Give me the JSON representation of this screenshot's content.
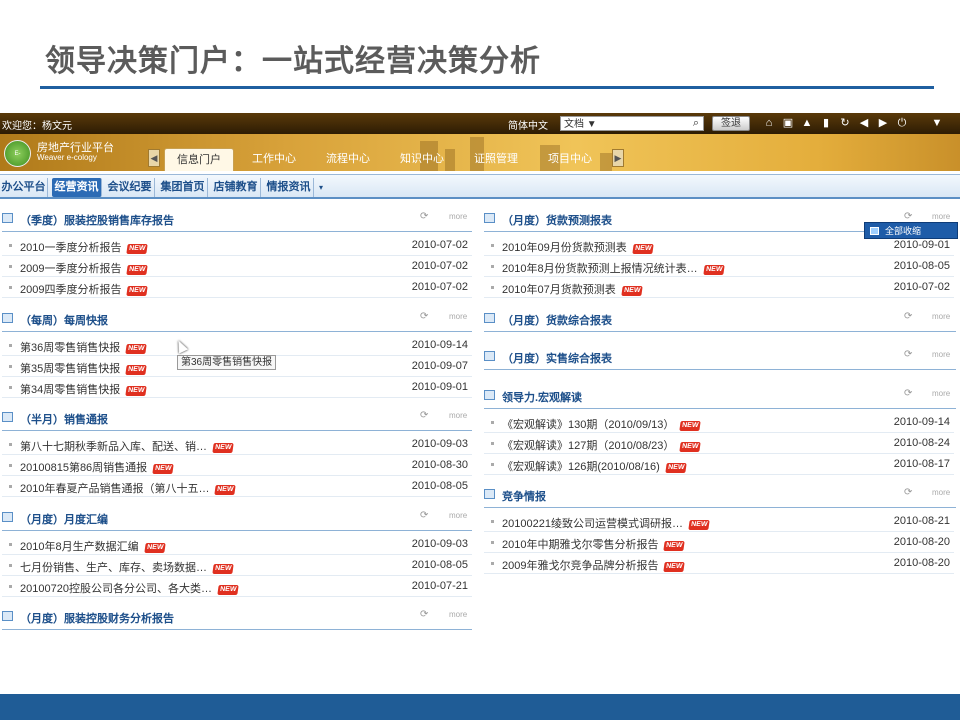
{
  "slide": {
    "title": "领导决策门户：一站式经营决策分析"
  },
  "topbar": {
    "welcome": "欢迎您：杨文元",
    "lang": "简体中文",
    "doc_select": "文档 ▼",
    "sign_button": "签退",
    "tools": [
      "home-icon",
      "window-icon",
      "up-icon",
      "bookmark-icon",
      "refresh-icon",
      "back-icon",
      "forward-icon",
      "power-icon",
      "dropdown-icon"
    ]
  },
  "banner": {
    "logo_text": "E-COLOGY",
    "brand_line1": "房地产行业平台",
    "brand_line2": "Weaver e-cology",
    "tabs": [
      {
        "label": "信息门户",
        "active": true
      },
      {
        "label": "工作中心",
        "active": false
      },
      {
        "label": "流程中心",
        "active": false
      },
      {
        "label": "知识中心",
        "active": false
      },
      {
        "label": "证照管理",
        "active": false
      },
      {
        "label": "项目中心",
        "active": false
      }
    ]
  },
  "subnav": {
    "tabs": [
      {
        "label": "办公平台",
        "active": false
      },
      {
        "label": "经营资讯",
        "active": true
      },
      {
        "label": "会议纪要",
        "active": false
      },
      {
        "label": "集团首页",
        "active": false
      },
      {
        "label": "店铺教育",
        "active": false
      },
      {
        "label": "情报资讯",
        "active": false
      }
    ]
  },
  "left": [
    {
      "title": "（季度）服装控股销售库存报告",
      "rows": [
        {
          "text": "2010一季度分析报告",
          "date": "2010-07-02"
        },
        {
          "text": "2009一季度分析报告",
          "date": "2010-07-02"
        },
        {
          "text": "2009四季度分析报告",
          "date": "2010-07-02"
        }
      ]
    },
    {
      "title": "（每周）每周快报",
      "rows": [
        {
          "text": "第36周零售销售快报",
          "date": "2010-09-14"
        },
        {
          "text": "第35周零售销售快报",
          "date": "2010-09-07"
        },
        {
          "text": "第34周零售销售快报",
          "date": "2010-09-01"
        }
      ]
    },
    {
      "title": "（半月）销售通报",
      "rows": [
        {
          "text": "第八十七期秋季新品入库、配送、销…",
          "date": "2010-09-03"
        },
        {
          "text": "20100815第86周销售通报",
          "date": "2010-08-30"
        },
        {
          "text": "2010年春夏产品销售通报（第八十五…",
          "date": "2010-08-05"
        }
      ]
    },
    {
      "title": "（月度）月度汇编",
      "rows": [
        {
          "text": "2010年8月生产数据汇编",
          "date": "2010-09-03"
        },
        {
          "text": "七月份销售、生产、库存、卖场数据…",
          "date": "2010-08-05"
        },
        {
          "text": "20100720控股公司各分公司、各大类…",
          "date": "2010-07-21"
        }
      ]
    },
    {
      "title": "（月度）服装控股财务分析报告",
      "rows": []
    }
  ],
  "right": [
    {
      "title": "（月度）货款预测报表",
      "rows": [
        {
          "text": "2010年09月份货款预测表",
          "date": "2010-09-01"
        },
        {
          "text": "2010年8月份货款预测上报情况统计表…",
          "date": "2010-08-05"
        },
        {
          "text": "2010年07月货款预测表",
          "date": "2010-07-02"
        }
      ]
    },
    {
      "title": "（月度）货款综合报表",
      "rows": []
    },
    {
      "title": "（月度）实售综合报表",
      "rows": []
    },
    {
      "title": "领导力.宏观解读",
      "rows": [
        {
          "text": "《宏观解读》130期（2010/09/13）",
          "date": "2010-09-14"
        },
        {
          "text": "《宏观解读》127期（2010/08/23）",
          "date": "2010-08-24"
        },
        {
          "text": "《宏观解读》126期(2010/08/16)",
          "date": "2010-08-17"
        }
      ]
    },
    {
      "title": "竞争情报",
      "rows": [
        {
          "text": "20100221绫致公司运营模式调研报…",
          "date": "2010-08-21"
        },
        {
          "text": "2010年中期雅戈尔零售分析报告",
          "date": "2010-08-20"
        },
        {
          "text": "2009年雅戈尔竞争品牌分析报告",
          "date": "2010-08-20"
        }
      ]
    }
  ],
  "common": {
    "more": "more",
    "new_badge": "NEW"
  },
  "tooltip": "第36周零售销售快报",
  "popup_menu": "全部收缩"
}
